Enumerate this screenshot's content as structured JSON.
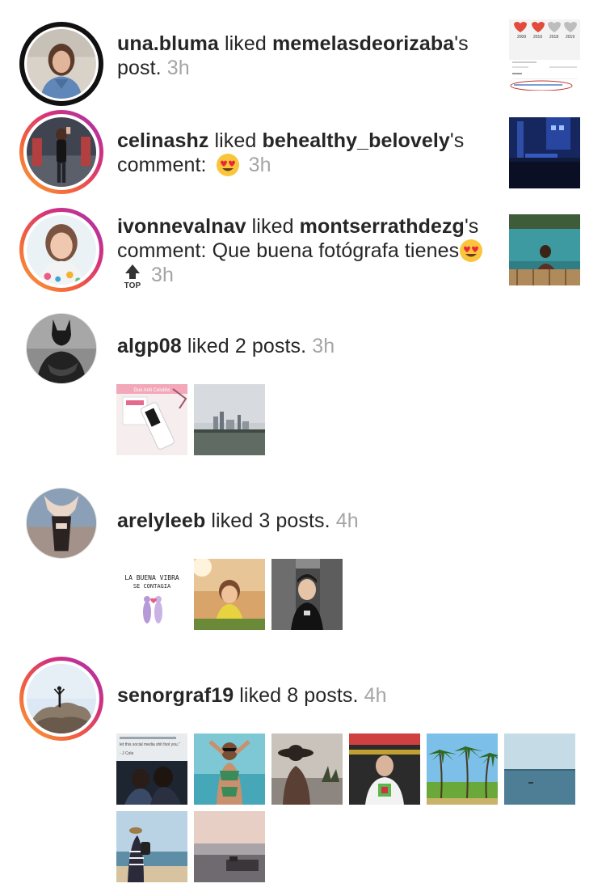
{
  "notifications": [
    {
      "user": "una.bluma",
      "action": "liked",
      "target_user": "memelasdeorizaba",
      "suffix": "'s post.",
      "time": "3h",
      "thumb_labels": [
        "2009",
        "2016",
        "2018",
        "2019"
      ]
    },
    {
      "user": "celinashz",
      "action": "liked",
      "target_user": "behealthy_belovely",
      "suffix": "'s comment:",
      "emoji": "heart-eyes-emoji",
      "time": "3h"
    },
    {
      "user": "ivonnevalnav",
      "action": "liked",
      "target_user": "montserrathdezg",
      "suffix": "'s comment: Que buena fotógrafa tienes",
      "emoji": "heart-eyes-emoji",
      "top_label": "TOP",
      "time": "3h"
    },
    {
      "user": "algp08",
      "action": "liked 2 posts.",
      "time": "3h",
      "thumb_text": "Duo Anti Celulitis"
    },
    {
      "user": "arelyleeb",
      "action": "liked 3 posts.",
      "time": "4h",
      "thumb_text": [
        "LA BUENA VIBRA",
        "SE CONTAGIA"
      ]
    },
    {
      "user": "senorgraf19",
      "action": "liked 8 posts.",
      "time": "4h",
      "thumb_text": [
        "let this social media shit fool you.\"",
        "- J Cole"
      ]
    }
  ],
  "colors": {
    "text": "#262626",
    "timestamp": "#a5a5a5",
    "story_ring": [
      "#f7a437",
      "#d5327b",
      "#a334b0"
    ]
  }
}
